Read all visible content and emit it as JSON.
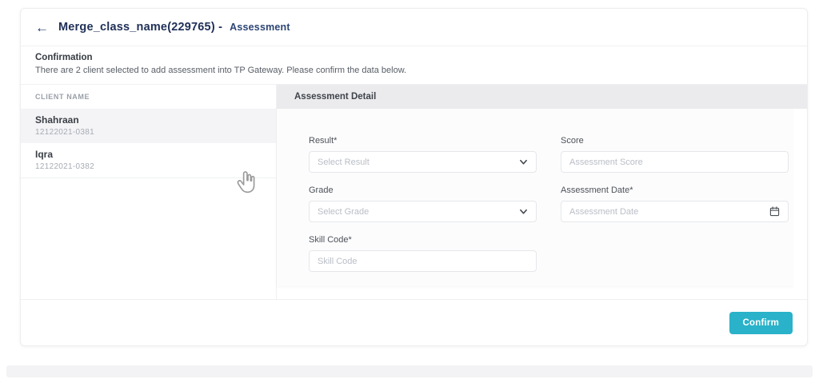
{
  "header": {
    "back_icon": "←",
    "title": "Merge_class_name(229765) -",
    "section": "Assessment"
  },
  "confirmation": {
    "heading": "Confirmation",
    "message": "There are 2 client selected to add assessment into TP Gateway. Please confirm the data below."
  },
  "client_panel": {
    "column_header": "CLIENT NAME",
    "clients": [
      {
        "name": "Shahraan",
        "id": "12122021-0381",
        "selected": true
      },
      {
        "name": "Iqra",
        "id": "12122021-0382",
        "selected": false
      }
    ]
  },
  "assessment_panel": {
    "header": "Assessment Detail",
    "form": {
      "result": {
        "label": "Result*",
        "placeholder": "Select Result",
        "type": "select"
      },
      "score": {
        "label": "Score",
        "placeholder": "Assessment Score",
        "type": "text"
      },
      "grade": {
        "label": "Grade",
        "placeholder": "Select Grade",
        "type": "select"
      },
      "assessment_date": {
        "label": "Assessment Date*",
        "placeholder": "Assessment Date",
        "type": "date"
      },
      "skill_code": {
        "label": "Skill Code*",
        "placeholder": "Skill Code",
        "type": "text"
      }
    }
  },
  "footer": {
    "confirm_label": "Confirm"
  },
  "icons": {
    "back": "arrow-left",
    "select": "chevron-down",
    "date": "calendar",
    "overlay": "hand-pointer"
  },
  "colors": {
    "accent": "#29b2c9",
    "title_navy": "#1f2f57",
    "panel_header_bg": "#ebebed",
    "selected_row_bg": "#f4f4f6"
  }
}
